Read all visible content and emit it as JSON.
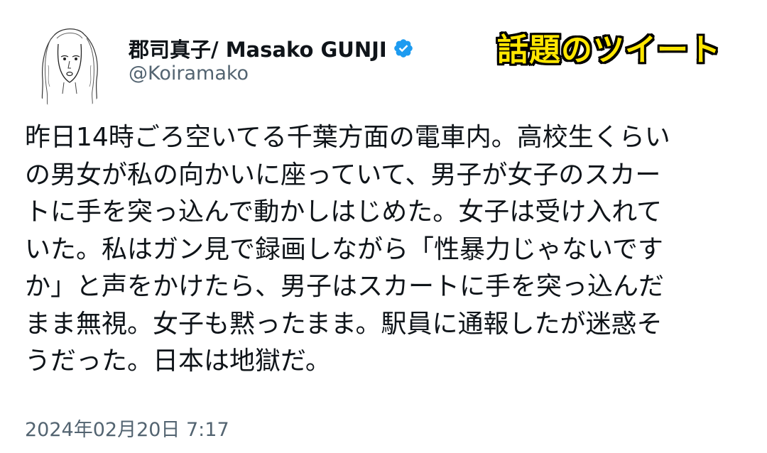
{
  "author": {
    "display_name": "郡司真子/ Masako GUNJI",
    "handle": "@Koiramako",
    "verified": true,
    "verified_color": "#1d9bf0"
  },
  "badge": {
    "label": "話題のツイート",
    "color": "#ffe600"
  },
  "tweet": {
    "text": "昨日14時ごろ空いてる千葉方面の電車内。高校生くらい\nの男女が私の向かいに座っていて、男子が女子のスカー\nトに手を突っ込んで動かしはじめた。女子は受け入れて\nいた。私はガン見で録画しながら「性暴力じゃないです\nか」と声をかけたら、男子はスカートに手を突っ込んだ\nまま無視。女子も黙ったまま。駅員に通報したが迷惑そ\nうだった。日本は地獄だ。",
    "timestamp": "2024年02月20日 7:17"
  },
  "colors": {
    "text_primary": "#0f1419",
    "text_secondary": "#536471"
  }
}
